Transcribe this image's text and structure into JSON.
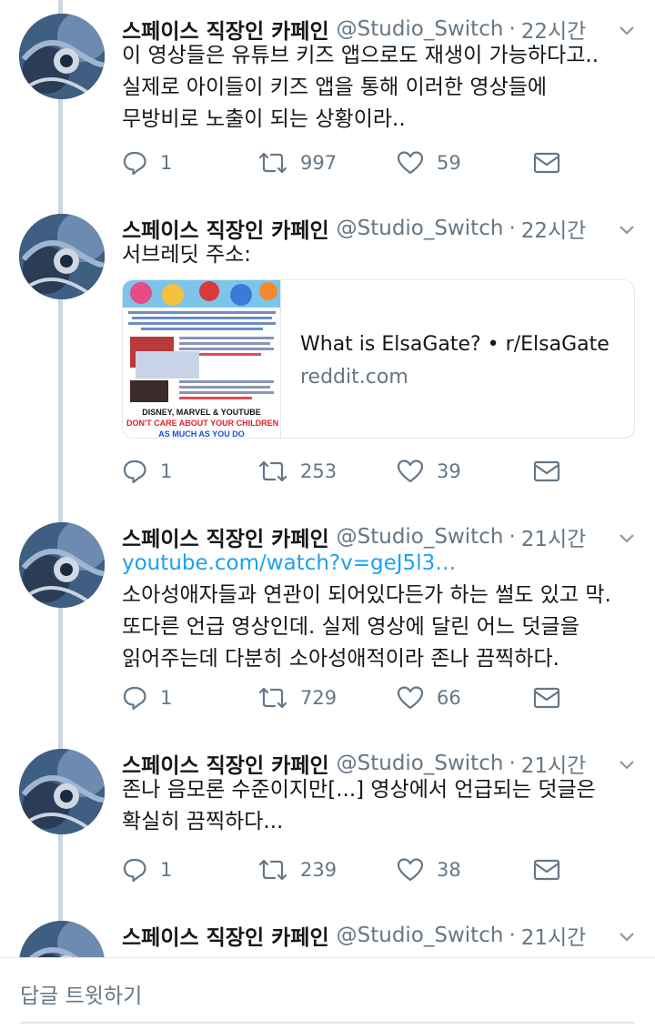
{
  "tweets": [
    {
      "name": "스페이스 직장인 카페인",
      "handle": "@Studio_Switch",
      "time": "22시간",
      "lines": [
        "이 영상들은 유튜브 키즈 앱으로도 재생이 가능하다고..",
        "실제로 아이들이 키즈 앱을 통해 이러한 영상들에",
        "무방비로 노출이 되는 상황이라.."
      ],
      "replies": "1",
      "retweets": "997",
      "likes": "59"
    },
    {
      "name": "스페이스 직장인 카페인",
      "handle": "@Studio_Switch",
      "time": "22시간",
      "lines": [
        "서브레딧 주소:"
      ],
      "card": {
        "title": "What is ElsaGate? • r/ElsaGate",
        "domain": "reddit.com",
        "thumb_caption_1": "DISNEY, MARVEL & YOUTUBE",
        "thumb_caption_2": "DON'T CARE ABOUT YOUR CHILDREN",
        "thumb_caption_3": "AS MUCH AS YOU DO"
      },
      "replies": "1",
      "retweets": "253",
      "likes": "39"
    },
    {
      "name": "스페이스 직장인 카페인",
      "handle": "@Studio_Switch",
      "time": "21시간",
      "link": "youtube.com/watch?v=geJ5l3…",
      "lines": [
        "소아성애자들과 연관이 되어있다든가 하는 썰도 있고 막.",
        "또다른 언급 영상인데. 실제 영상에 달린 어느 덧글을",
        "읽어주는데 다분히 소아성애적이라 존나 끔찍하다."
      ],
      "replies": "1",
      "retweets": "729",
      "likes": "66"
    },
    {
      "name": "스페이스 직장인 카페인",
      "handle": "@Studio_Switch",
      "time": "21시간",
      "lines": [
        "존나 음모론 수준이지만[...] 영상에서 언급되는 덧글은",
        "확실히 끔찍하다..."
      ],
      "replies": "1",
      "retweets": "239",
      "likes": "38"
    },
    {
      "name": "스페이스 직장인 카페인",
      "handle": "@Studio_Switch",
      "time": "21시간"
    }
  ],
  "reply_bar": {
    "placeholder": "답글 트윗하기"
  },
  "colors": {
    "link": "#1da1f2",
    "muted": "#657786",
    "thread_line": "#ccd6dd"
  },
  "icons": [
    "reply-icon",
    "retweet-icon",
    "like-icon",
    "dm-icon",
    "chevron-down-icon"
  ]
}
